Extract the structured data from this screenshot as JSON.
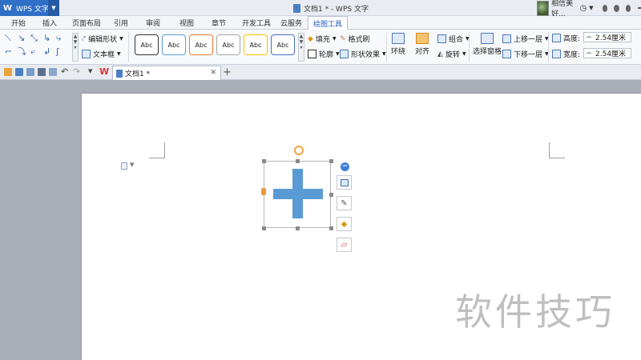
{
  "app": {
    "menu_label": "WPS 文字",
    "logo": "W",
    "title": "文档1 * - WPS 文字"
  },
  "user": {
    "name": "相信美好..."
  },
  "tabs": [
    "开始",
    "插入",
    "页面布局",
    "引用",
    "审阅",
    "视图",
    "章节",
    "开发工具",
    "云服务",
    "绘图工具"
  ],
  "active_tab": "绘图工具",
  "ribbon": {
    "edit_shape": "编辑形状",
    "text_box": "文本框",
    "style_label": "Abc",
    "fill": "填充",
    "format_brush": "格式刷",
    "outline": "轮廓",
    "shape_effects": "形状效果",
    "wrap": "环绕",
    "align": "对齐",
    "group": "组合",
    "rotate": "旋转",
    "selection_pane": "选择窗格",
    "bring_forward": "上移一层",
    "send_backward": "下移一层",
    "height_label": "高度:",
    "height_value": "2.54厘米",
    "width_label": "宽度:",
    "width_value": "2.54厘米"
  },
  "document_tab": {
    "name": "文档1 *"
  },
  "colors": {
    "accent": "#2f6fc6",
    "shape_fill": "#5b9bd5",
    "rotate_handle": "#f0a43b"
  },
  "watermark": "软件技巧"
}
